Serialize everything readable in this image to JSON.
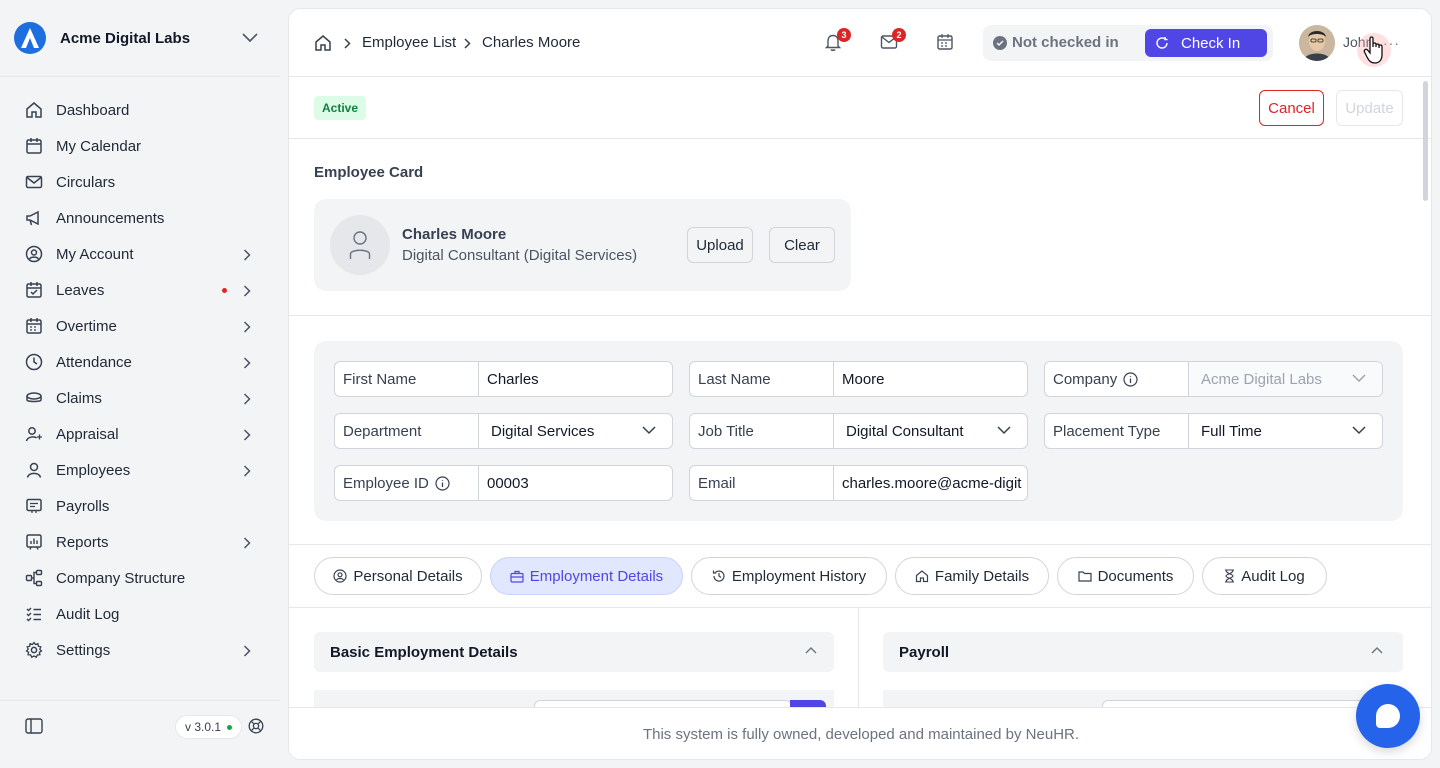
{
  "brand": {
    "name": "Acme Digital Labs"
  },
  "sidebar": {
    "items": [
      {
        "label": "Dashboard",
        "icon": "home-icon",
        "chevron": false
      },
      {
        "label": "My Calendar",
        "icon": "calendar-icon",
        "chevron": false
      },
      {
        "label": "Circulars",
        "icon": "mail-icon",
        "chevron": false
      },
      {
        "label": "Announcements",
        "icon": "megaphone-icon",
        "chevron": false
      },
      {
        "label": "My Account",
        "icon": "user-circle-icon",
        "chevron": true
      },
      {
        "label": "Leaves",
        "icon": "calendar-check-icon",
        "chevron": true,
        "dot": true
      },
      {
        "label": "Overtime",
        "icon": "calendar-plus-icon",
        "chevron": true
      },
      {
        "label": "Attendance",
        "icon": "clock-icon",
        "chevron": true
      },
      {
        "label": "Claims",
        "icon": "coins-icon",
        "chevron": true
      },
      {
        "label": "Appraisal",
        "icon": "user-star-icon",
        "chevron": true
      },
      {
        "label": "Employees",
        "icon": "user-icon",
        "chevron": true
      },
      {
        "label": "Payrolls",
        "icon": "receipt-icon",
        "chevron": false
      },
      {
        "label": "Reports",
        "icon": "report-icon",
        "chevron": true
      },
      {
        "label": "Company Structure",
        "icon": "hierarchy-icon",
        "chevron": false
      },
      {
        "label": "Audit Log",
        "icon": "list-check-icon",
        "chevron": false
      },
      {
        "label": "Settings",
        "icon": "gear-icon",
        "chevron": true
      }
    ],
    "version": "v 3.0.1"
  },
  "topbar": {
    "breadcrumb": [
      "Employee List",
      "Charles Moore"
    ],
    "notifications_count": "3",
    "messages_count": "2",
    "status_text": "Not checked in",
    "check_in_label": "Check In",
    "user_name": "John",
    "more": "···"
  },
  "actions": {
    "status": "Active",
    "cancel_label": "Cancel",
    "update_label": "Update"
  },
  "card": {
    "section_title": "Employee Card",
    "name": "Charles Moore",
    "role": "Digital Consultant (Digital Services)",
    "upload_label": "Upload",
    "clear_label": "Clear"
  },
  "fields": {
    "first_name": {
      "label": "First Name",
      "value": "Charles"
    },
    "last_name": {
      "label": "Last Name",
      "value": "Moore"
    },
    "company": {
      "label": "Company",
      "value": "Acme Digital Labs"
    },
    "department": {
      "label": "Department",
      "value": "Digital Services"
    },
    "job_title": {
      "label": "Job Title",
      "value": "Digital Consultant"
    },
    "placement_type": {
      "label": "Placement Type",
      "value": "Full Time"
    },
    "employee_id": {
      "label": "Employee ID",
      "value": "00003"
    },
    "email": {
      "label": "Email",
      "value": "charles.moore@acme-digit"
    }
  },
  "tabs": [
    {
      "label": "Personal Details",
      "icon": "user-circle-icon"
    },
    {
      "label": "Employment Details",
      "icon": "briefcase-icon",
      "active": true
    },
    {
      "label": "Employment History",
      "icon": "history-icon"
    },
    {
      "label": "Family Details",
      "icon": "home-icon"
    },
    {
      "label": "Documents",
      "icon": "folder-icon"
    },
    {
      "label": "Audit Log",
      "icon": "hourglass-icon"
    }
  ],
  "panels": {
    "left_title": "Basic Employment Details",
    "right_title": "Payroll"
  },
  "footer": {
    "text": "This system is fully owned, developed and maintained by NeuHR."
  },
  "colors": {
    "accent": "#4f46e5",
    "danger": "#dc2626",
    "brand": "#1d6fe0",
    "success": "#15803d"
  }
}
